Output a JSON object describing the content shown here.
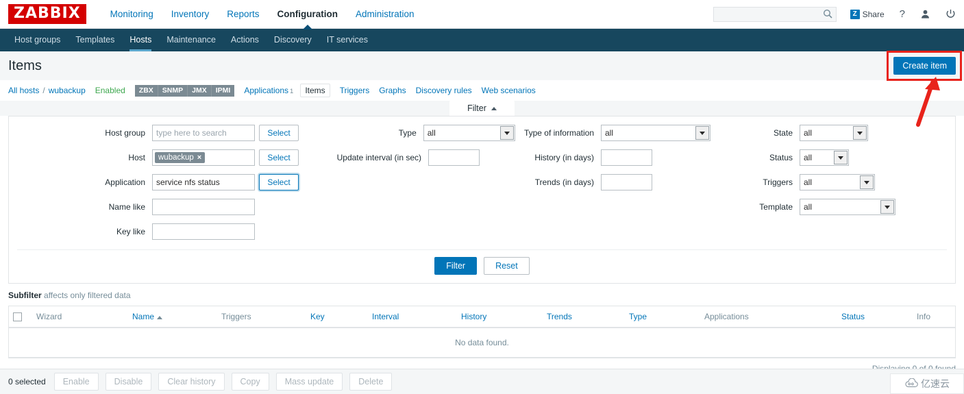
{
  "brand": {
    "logo": "ZABBIX"
  },
  "topnav": {
    "items": [
      {
        "label": "Monitoring",
        "selected": false
      },
      {
        "label": "Inventory",
        "selected": false
      },
      {
        "label": "Reports",
        "selected": false
      },
      {
        "label": "Configuration",
        "selected": true
      },
      {
        "label": "Administration",
        "selected": false
      }
    ],
    "search_placeholder": "",
    "search_value": "",
    "share_label": "Share",
    "help_label": "?"
  },
  "subnav": {
    "items": [
      {
        "label": "Host groups",
        "selected": false
      },
      {
        "label": "Templates",
        "selected": false
      },
      {
        "label": "Hosts",
        "selected": true
      },
      {
        "label": "Maintenance",
        "selected": false
      },
      {
        "label": "Actions",
        "selected": false
      },
      {
        "label": "Discovery",
        "selected": false
      },
      {
        "label": "IT services",
        "selected": false
      }
    ]
  },
  "header": {
    "title": "Items",
    "create_button": "Create item"
  },
  "breadcrumb": {
    "all_hosts": "All hosts",
    "separator": "/",
    "host": "wubackup",
    "status": "Enabled",
    "badges": [
      "ZBX",
      "SNMP",
      "JMX",
      "IPMI"
    ],
    "links": [
      {
        "label": "Applications",
        "count": "1",
        "selected": false
      },
      {
        "label": "Items",
        "count": "",
        "selected": true
      },
      {
        "label": "Triggers",
        "count": "",
        "selected": false
      },
      {
        "label": "Graphs",
        "count": "",
        "selected": false
      },
      {
        "label": "Discovery rules",
        "count": "",
        "selected": false
      },
      {
        "label": "Web scenarios",
        "count": "",
        "selected": false
      }
    ]
  },
  "filter": {
    "tab_label": "Filter",
    "col1": {
      "host_group_label": "Host group",
      "host_group_placeholder": "type here to search",
      "host_group_value": "",
      "host_group_select": "Select",
      "host_label": "Host",
      "host_chip": "wubackup",
      "host_chip_remove": "×",
      "host_select": "Select",
      "application_label": "Application",
      "application_value": "service nfs status",
      "application_select": "Select",
      "name_like_label": "Name like",
      "name_like_value": "",
      "key_like_label": "Key like",
      "key_like_value": ""
    },
    "col2": {
      "type_label": "Type",
      "type_value": "all",
      "update_interval_label": "Update interval (in sec)",
      "update_interval_value": ""
    },
    "col3": {
      "type_of_information_label": "Type of information",
      "type_of_information_value": "all",
      "history_label": "History (in days)",
      "history_value": "",
      "trends_label": "Trends (in days)",
      "trends_value": ""
    },
    "col4": {
      "state_label": "State",
      "state_value": "all",
      "status_label": "Status",
      "status_value": "all",
      "triggers_label": "Triggers",
      "triggers_value": "all",
      "template_label": "Template",
      "template_value": "all"
    },
    "filter_button": "Filter",
    "reset_button": "Reset"
  },
  "subfilter": {
    "title": "Subfilter",
    "hint": "affects only filtered data"
  },
  "table": {
    "columns": [
      {
        "label": "Wizard",
        "sortable": false,
        "sorted": ""
      },
      {
        "label": "Name",
        "sortable": true,
        "sorted": "asc"
      },
      {
        "label": "Triggers",
        "sortable": false,
        "sorted": ""
      },
      {
        "label": "Key",
        "sortable": true,
        "sorted": ""
      },
      {
        "label": "Interval",
        "sortable": true,
        "sorted": ""
      },
      {
        "label": "History",
        "sortable": true,
        "sorted": ""
      },
      {
        "label": "Trends",
        "sortable": true,
        "sorted": ""
      },
      {
        "label": "Type",
        "sortable": true,
        "sorted": ""
      },
      {
        "label": "Applications",
        "sortable": false,
        "sorted": ""
      },
      {
        "label": "Status",
        "sortable": true,
        "sorted": ""
      },
      {
        "label": "Info",
        "sortable": false,
        "sorted": ""
      }
    ],
    "empty_message": "No data found.",
    "displaying": "Displaying 0 of 0 found"
  },
  "footer": {
    "selected_count": "0 selected",
    "actions": [
      "Enable",
      "Disable",
      "Clear history",
      "Copy",
      "Mass update",
      "Delete"
    ]
  },
  "watermark": {
    "text": "亿速云"
  },
  "colors": {
    "accent": "#0275b8",
    "nav_dark": "#17475e",
    "brand_red": "#d40000",
    "enabled_green": "#3da74e",
    "annotation_red": "#e8231b",
    "badge_gray": "#7b8a93"
  }
}
